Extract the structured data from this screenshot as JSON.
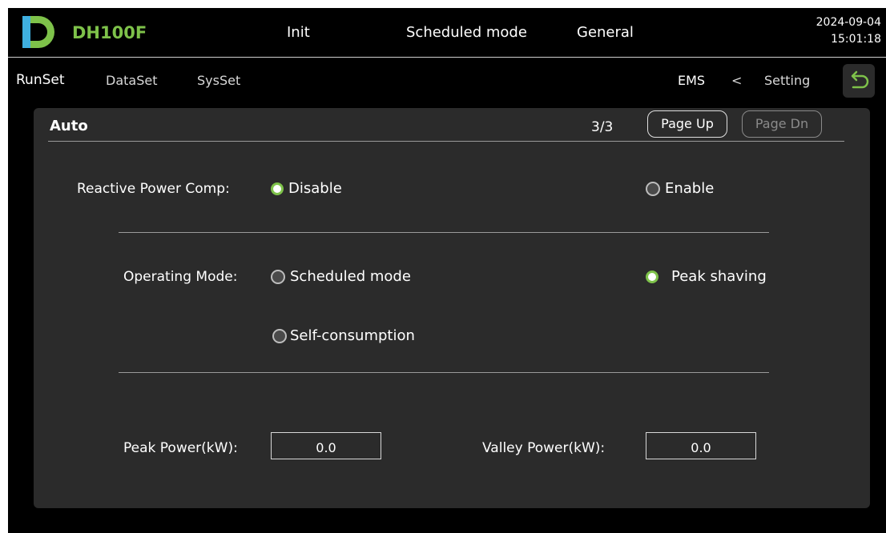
{
  "header": {
    "brand": "DH100F",
    "status_init": "Init",
    "status_mode": "Scheduled mode",
    "status_general": "General",
    "date": "2024-09-04",
    "time": "15:01:18"
  },
  "nav": {
    "tabs": [
      "RunSet",
      "DataSet",
      "SysSet"
    ],
    "breadcrumb_ems": "EMS",
    "breadcrumb_sep": "<",
    "breadcrumb_setting": "Setting",
    "back_icon": "return-arrow-icon"
  },
  "panel": {
    "title": "Auto",
    "page_indicator": "3/3",
    "page_up": "Page Up",
    "page_dn": "Page Dn"
  },
  "reactive": {
    "label": "Reactive Power Comp:",
    "options": [
      "Disable",
      "Enable"
    ],
    "selected": "Disable"
  },
  "operating_mode": {
    "label": "Operating Mode:",
    "options": [
      "Scheduled mode",
      "Peak shaving",
      "Self-consumption"
    ],
    "selected": "Peak shaving"
  },
  "power": {
    "peak_label": "Peak Power(kW):",
    "peak_value": "0.0",
    "valley_label": "Valley Power(kW):",
    "valley_value": "0.0"
  },
  "colors": {
    "accent": "#7ec24a",
    "background": "#000000",
    "panel": "#2b2b2b"
  }
}
